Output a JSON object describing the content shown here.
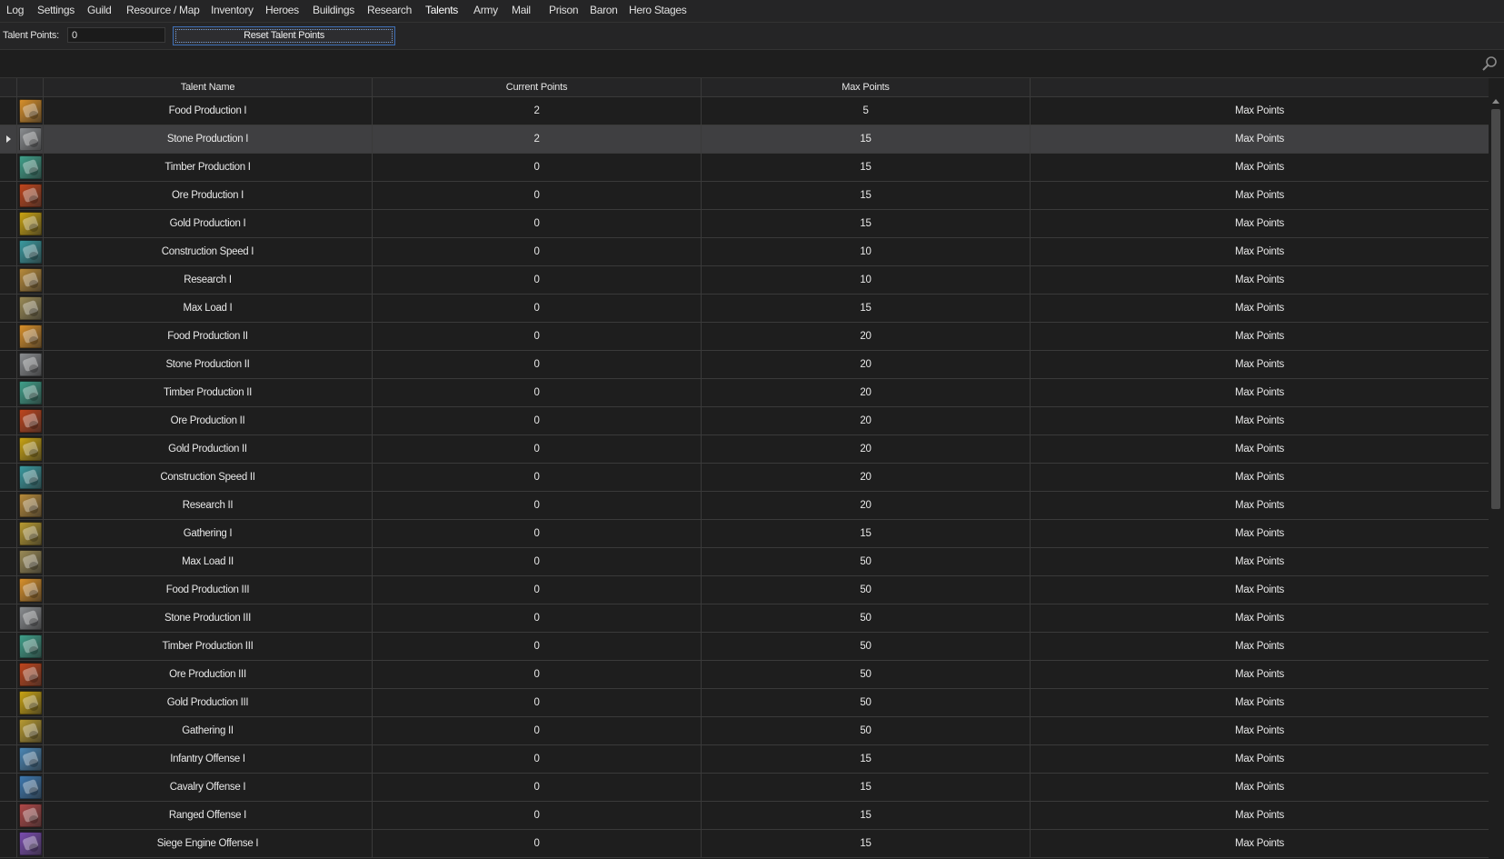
{
  "menu": {
    "items": [
      {
        "label": "Log",
        "name": "menu-log"
      },
      {
        "label": "Settings",
        "name": "menu-settings"
      },
      {
        "label": "Guild",
        "name": "menu-guild"
      },
      {
        "label": "Resource / Map",
        "name": "menu-resource-map"
      },
      {
        "label": "Inventory",
        "name": "menu-inventory"
      },
      {
        "label": "Heroes",
        "name": "menu-heroes"
      },
      {
        "label": "Buildings",
        "name": "menu-buildings"
      },
      {
        "label": "Research",
        "name": "menu-research"
      },
      {
        "label": "Talents",
        "name": "menu-talents",
        "active": true
      },
      {
        "label": "Army",
        "name": "menu-army"
      },
      {
        "label": "Mail",
        "name": "menu-mail"
      },
      {
        "label": "Prison",
        "name": "menu-prison"
      },
      {
        "label": "Baron",
        "name": "menu-baron"
      },
      {
        "label": "Hero Stages",
        "name": "menu-hero-stages"
      }
    ]
  },
  "toolbar": {
    "talent_points_label": "Talent Points:",
    "talent_points_value": "0",
    "reset_label": "Reset Talent Points"
  },
  "grid": {
    "headers": {
      "name": "Talent Name",
      "current": "Current Points",
      "max": "Max Points",
      "extra": ""
    },
    "rows": [
      {
        "name": "Food Production I",
        "current": "2",
        "max": "5",
        "extra": "Max Points",
        "icon": "food-icon"
      },
      {
        "name": "Stone Production I",
        "current": "2",
        "max": "15",
        "extra": "Max Points",
        "icon": "stone-icon",
        "selected": true
      },
      {
        "name": "Timber Production I",
        "current": "0",
        "max": "15",
        "extra": "Max Points",
        "icon": "timber-icon"
      },
      {
        "name": "Ore Production I",
        "current": "0",
        "max": "15",
        "extra": "Max Points",
        "icon": "ore-icon"
      },
      {
        "name": "Gold Production I",
        "current": "0",
        "max": "15",
        "extra": "Max Points",
        "icon": "gold-icon"
      },
      {
        "name": "Construction Speed I",
        "current": "0",
        "max": "10",
        "extra": "Max Points",
        "icon": "construction-icon"
      },
      {
        "name": "Research I",
        "current": "0",
        "max": "10",
        "extra": "Max Points",
        "icon": "research-icon"
      },
      {
        "name": "Max Load I",
        "current": "0",
        "max": "15",
        "extra": "Max Points",
        "icon": "load-icon"
      },
      {
        "name": "Food Production II",
        "current": "0",
        "max": "20",
        "extra": "Max Points",
        "icon": "food-icon"
      },
      {
        "name": "Stone Production II",
        "current": "0",
        "max": "20",
        "extra": "Max Points",
        "icon": "stone-icon"
      },
      {
        "name": "Timber Production II",
        "current": "0",
        "max": "20",
        "extra": "Max Points",
        "icon": "timber-icon"
      },
      {
        "name": "Ore Production II",
        "current": "0",
        "max": "20",
        "extra": "Max Points",
        "icon": "ore-icon"
      },
      {
        "name": "Gold Production II",
        "current": "0",
        "max": "20",
        "extra": "Max Points",
        "icon": "gold-icon"
      },
      {
        "name": "Construction Speed II",
        "current": "0",
        "max": "20",
        "extra": "Max Points",
        "icon": "construction-icon"
      },
      {
        "name": "Research II",
        "current": "0",
        "max": "20",
        "extra": "Max Points",
        "icon": "research-icon"
      },
      {
        "name": "Gathering I",
        "current": "0",
        "max": "15",
        "extra": "Max Points",
        "icon": "gathering-icon"
      },
      {
        "name": "Max Load II",
        "current": "0",
        "max": "50",
        "extra": "Max Points",
        "icon": "load-icon"
      },
      {
        "name": "Food Production III",
        "current": "0",
        "max": "50",
        "extra": "Max Points",
        "icon": "food-icon"
      },
      {
        "name": "Stone Production III",
        "current": "0",
        "max": "50",
        "extra": "Max Points",
        "icon": "stone-icon"
      },
      {
        "name": "Timber Production III",
        "current": "0",
        "max": "50",
        "extra": "Max Points",
        "icon": "timber-icon"
      },
      {
        "name": "Ore Production III",
        "current": "0",
        "max": "50",
        "extra": "Max Points",
        "icon": "ore-icon"
      },
      {
        "name": "Gold Production III",
        "current": "0",
        "max": "50",
        "extra": "Max Points",
        "icon": "gold-icon"
      },
      {
        "name": "Gathering II",
        "current": "0",
        "max": "50",
        "extra": "Max Points",
        "icon": "gathering-icon"
      },
      {
        "name": "Infantry Offense I",
        "current": "0",
        "max": "15",
        "extra": "Max Points",
        "icon": "infantry-icon"
      },
      {
        "name": "Cavalry Offense I",
        "current": "0",
        "max": "15",
        "extra": "Max Points",
        "icon": "cavalry-icon"
      },
      {
        "name": "Ranged Offense I",
        "current": "0",
        "max": "15",
        "extra": "Max Points",
        "icon": "ranged-icon"
      },
      {
        "name": "Siege Engine Offense I",
        "current": "0",
        "max": "15",
        "extra": "Max Points",
        "icon": "siege-icon"
      }
    ]
  },
  "colors": {
    "background": "#1e1e1e",
    "selected_row": "#3f3f41",
    "button_border": "#3e6fb5",
    "icon_food": "#d9902a",
    "icon_stone": "#8a8d90",
    "icon_timber": "#3fa08a",
    "icon_ore": "#c0451c",
    "icon_gold": "#c9a312",
    "icon_construction": "#3a9aa0",
    "icon_research": "#b88a3a",
    "icon_load": "#9a8a55",
    "icon_gathering": "#b89a30",
    "icon_infantry": "#4a86b5",
    "icon_cavalry": "#3d78b0",
    "icon_ranged": "#b04848",
    "icon_siege": "#7a4cb0"
  }
}
